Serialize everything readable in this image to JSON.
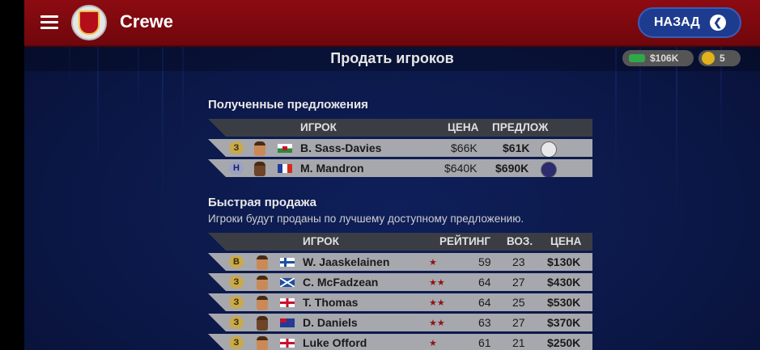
{
  "header": {
    "club_name": "Crewe",
    "back_label": "НАЗАД"
  },
  "subheader": {
    "title": "Продать игроков",
    "money": "$106K",
    "coins": "5"
  },
  "offers": {
    "title": "Полученные предложения",
    "columns": {
      "player": "ИГРОК",
      "price": "ЦЕНА",
      "offer": "ПРЕДЛОЖ"
    },
    "rows": [
      {
        "pos": "З",
        "flag": "wales",
        "name": "B. Sass-Davies",
        "price": "$66K",
        "offer": "$61K",
        "club_icon": "club-crest-icon"
      },
      {
        "pos": "Н",
        "flag": "france",
        "name": "M. Mandron",
        "price": "$640K",
        "offer": "$690K",
        "club_icon": "club-crest-icon"
      }
    ]
  },
  "quick_sale": {
    "title": "Быстрая продажа",
    "subtitle": "Игроки будут проданы по лучшему доступному предложению.",
    "columns": {
      "player": "ИГРОК",
      "rating": "РЕЙТИНГ",
      "age": "ВОЗ.",
      "price": "ЦЕНА"
    },
    "rows": [
      {
        "pos": "В",
        "flag": "finland",
        "name": "W. Jaaskelainen",
        "stars": "★",
        "rating": "59",
        "age": "23",
        "price": "$130K"
      },
      {
        "pos": "З",
        "flag": "scotland",
        "name": "C. McFadzean",
        "stars": "★★",
        "rating": "64",
        "age": "27",
        "price": "$430K"
      },
      {
        "pos": "З",
        "flag": "england",
        "name": "T. Thomas",
        "stars": "★★",
        "rating": "64",
        "age": "25",
        "price": "$530K"
      },
      {
        "pos": "З",
        "flag": "new-zealand",
        "name": "D. Daniels",
        "stars": "★★",
        "rating": "63",
        "age": "27",
        "price": "$370K"
      },
      {
        "pos": "З",
        "flag": "england",
        "name": "Luke Offord",
        "stars": "★",
        "rating": "61",
        "age": "21",
        "price": "$250K"
      }
    ]
  },
  "colors": {
    "topbar": "#8d0b12",
    "background": "#0b1848",
    "back_button": "#1d3c8f",
    "row": "#a6a8ad",
    "header_row": "#3a3d44",
    "star": "#8f1212"
  }
}
